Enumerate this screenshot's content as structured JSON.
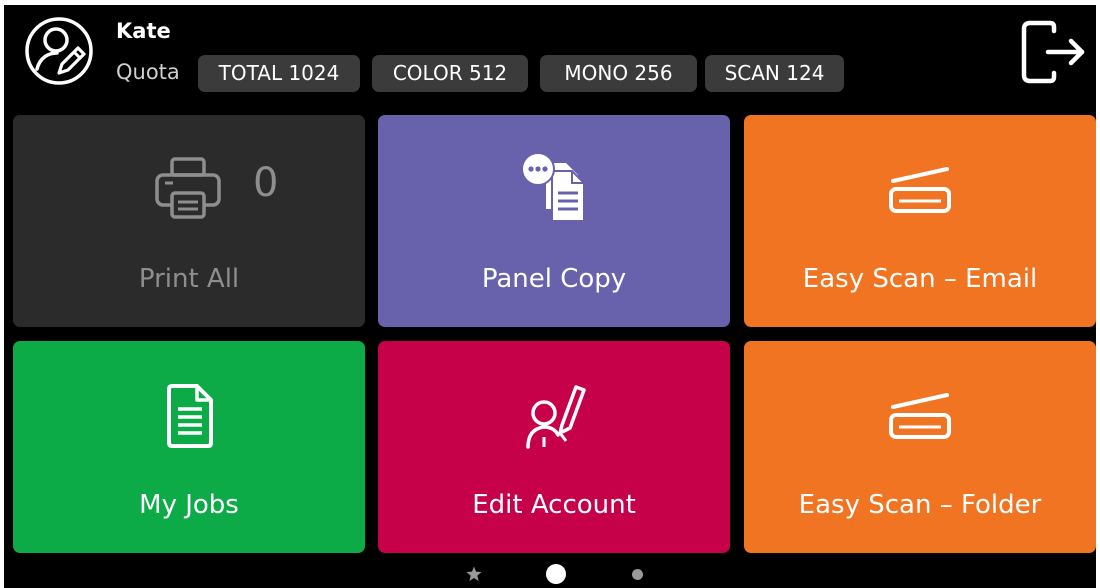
{
  "user": {
    "name": "Kate",
    "avatar_icon": "user-edit-icon"
  },
  "quota": {
    "label": "Quota",
    "total": "TOTAL 1024",
    "color": "COLOR 512",
    "mono": "MONO 256",
    "scan": "SCAN 124"
  },
  "header": {
    "logout_icon": "logout-icon"
  },
  "tiles": [
    {
      "id": "print-all",
      "label": "Print All",
      "count": "0",
      "icon": "printer-icon",
      "color": "#2b2b2b"
    },
    {
      "id": "panel-copy",
      "label": "Panel Copy",
      "icon": "copy-documents-icon",
      "color": "#6862ad"
    },
    {
      "id": "easy-scan-email",
      "label": "Easy Scan – Email",
      "icon": "scanner-icon",
      "color": "#f07421"
    },
    {
      "id": "my-jobs",
      "label": "My Jobs",
      "icon": "document-icon",
      "color": "#0cab48"
    },
    {
      "id": "edit-account",
      "label": "Edit Account",
      "icon": "user-pen-icon",
      "color": "#c7004a"
    },
    {
      "id": "easy-scan-folder",
      "label": "Easy Scan – Folder",
      "icon": "scanner-icon",
      "color": "#f07421"
    }
  ],
  "pager": {
    "pages": 3,
    "active_page": 2,
    "first_page_icon": "star-icon"
  }
}
